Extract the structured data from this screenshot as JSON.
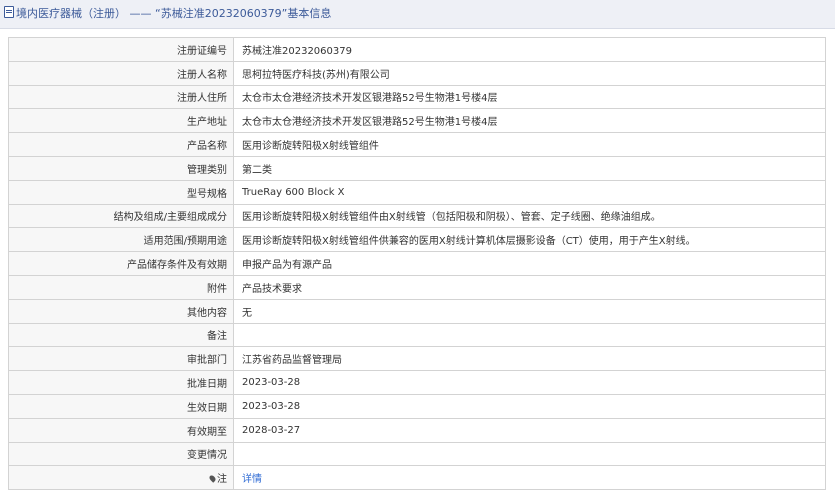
{
  "header": {
    "category": "境内医疗器械（注册）",
    "separator": "——",
    "record_title": "“苏械注准20232060379”基本信息"
  },
  "rows": [
    {
      "label": "注册证编号",
      "value": "苏械注准20232060379"
    },
    {
      "label": "注册人名称",
      "value": "思柯拉特医疗科技(苏州)有限公司"
    },
    {
      "label": "注册人住所",
      "value": "太仓市太仓港经济技术开发区银港路52号生物港1号楼4层"
    },
    {
      "label": "生产地址",
      "value": "太仓市太仓港经济技术开发区银港路52号生物港1号楼4层"
    },
    {
      "label": "产品名称",
      "value": "医用诊断旋转阳极X射线管组件"
    },
    {
      "label": "管理类别",
      "value": "第二类"
    },
    {
      "label": "型号规格",
      "value": "TrueRay 600 Block X"
    },
    {
      "label": "结构及组成/主要组成成分",
      "value": "医用诊断旋转阳极X射线管组件由X射线管（包括阳极和阴极）、管套、定子线圈、绝缘油组成。"
    },
    {
      "label": "适用范围/预期用途",
      "value": "医用诊断旋转阳极X射线管组件供兼容的医用X射线计算机体层摄影设备（CT）使用，用于产生X射线。"
    },
    {
      "label": "产品储存条件及有效期",
      "value": "申报产品为有源产品"
    },
    {
      "label": "附件",
      "value": "产品技术要求"
    },
    {
      "label": "其他内容",
      "value": "无"
    },
    {
      "label": "备注",
      "value": ""
    },
    {
      "label": "审批部门",
      "value": "江苏省药品监督管理局"
    },
    {
      "label": "批准日期",
      "value": "2023-03-28"
    },
    {
      "label": "生效日期",
      "value": "2023-03-28"
    },
    {
      "label": "有效期至",
      "value": "2028-03-27"
    },
    {
      "label": "变更情况",
      "value": ""
    }
  ],
  "note_row": {
    "label": "注",
    "link_text": "详情",
    "icon": "pin-icon"
  },
  "colors": {
    "title_text": "#3c5a99",
    "link": "#2f6bd4",
    "label_bg": "#f7f7f7",
    "border": "#d3d3d3"
  }
}
